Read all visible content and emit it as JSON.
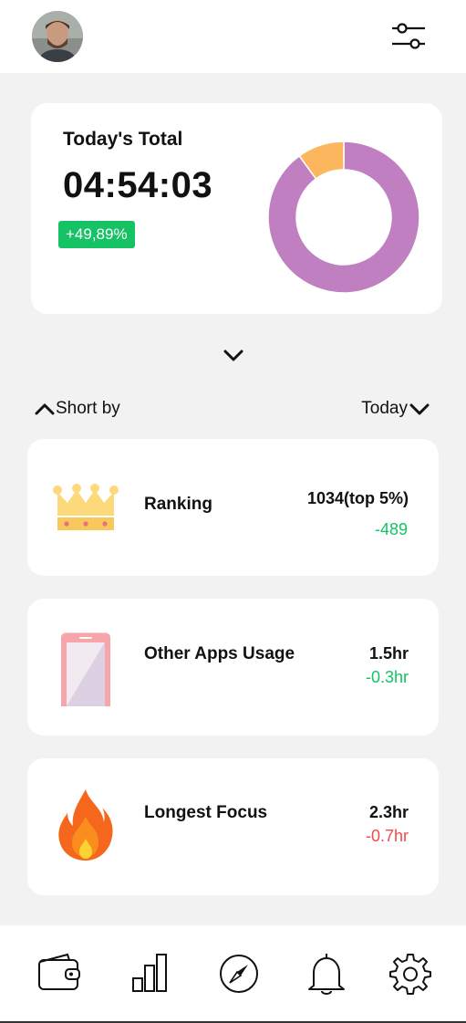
{
  "header": {
    "avatar_icon": "user-avatar",
    "filter_icon": "sliders-icon"
  },
  "summary": {
    "title": "Today's Total",
    "time": "04:54:03",
    "change": "+49,89%",
    "change_color": "#15c264",
    "chart_data": {
      "type": "pie",
      "style": "donut",
      "values": [
        90,
        10
      ],
      "colors": [
        "#bf7fc0",
        "#fcb75e"
      ]
    }
  },
  "controls": {
    "sort_label": "Short by",
    "period_label": "Today"
  },
  "stats": [
    {
      "label": "Ranking",
      "value": "1034(top 5%)",
      "delta": "-489",
      "delta_color": "#15c264",
      "icon": "crown-icon"
    },
    {
      "label": "Other Apps Usage",
      "value": "1.5hr",
      "delta": "-0.3hr",
      "delta_color": "#15c264",
      "icon": "phone-icon"
    },
    {
      "label": "Longest Focus",
      "value": "2.3hr",
      "delta": "-0.7hr",
      "delta_color": "#f24b4b",
      "icon": "fire-icon"
    }
  ],
  "nav": [
    "wallet-icon",
    "bar-chart-icon",
    "compass-icon",
    "bell-icon",
    "gear-icon"
  ]
}
